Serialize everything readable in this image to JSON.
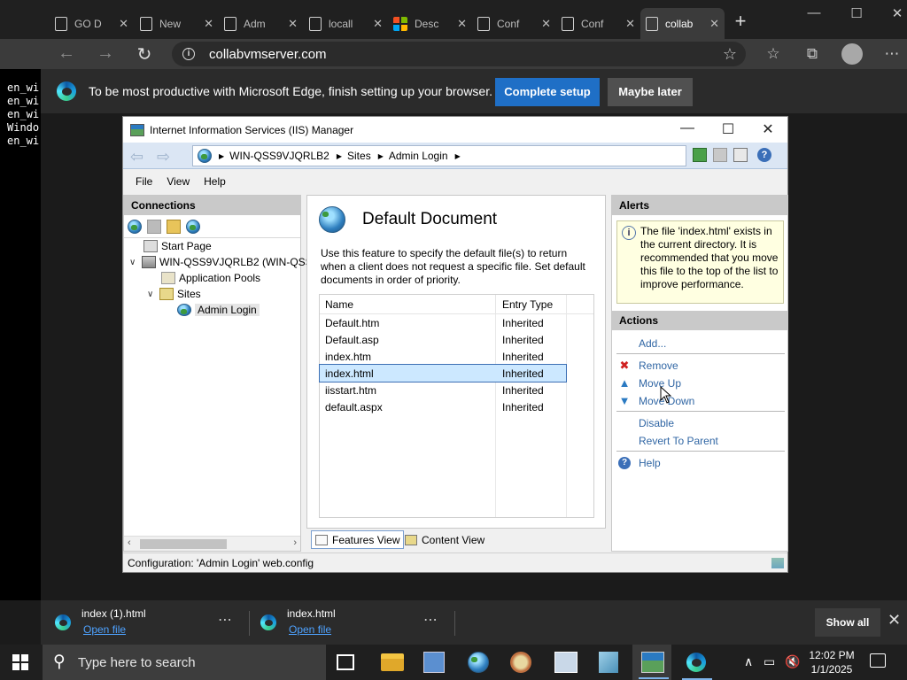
{
  "browser": {
    "tabs": [
      {
        "label": "GO D"
      },
      {
        "label": "New"
      },
      {
        "label": "Adm"
      },
      {
        "label": "locall"
      },
      {
        "label": "Desc"
      },
      {
        "label": "Conf"
      },
      {
        "label": "Conf"
      },
      {
        "label": "collab"
      }
    ],
    "url": "collabvmserver.com",
    "infobar": {
      "message": "To be most productive with Microsoft Edge, finish setting up your browser.",
      "primary_button": "Complete setup",
      "secondary_button": "Maybe later"
    }
  },
  "console": {
    "lines": [
      "en_wir",
      "en_wir",
      "en_wir",
      "Windo",
      "en_wir"
    ]
  },
  "iis": {
    "title": "Internet Information Services (IIS) Manager",
    "breadcrumb": [
      "WIN-QSS9VJQRLB2",
      "Sites",
      "Admin Login"
    ],
    "menu": [
      "File",
      "View",
      "Help"
    ],
    "connections": {
      "header": "Connections",
      "tree": {
        "start_page": "Start Page",
        "server": "WIN-QSS9VJQRLB2 (WIN-QSS",
        "app_pools": "Application Pools",
        "sites": "Sites",
        "site": "Admin Login"
      }
    },
    "feature": {
      "title": "Default Document",
      "description": "Use this feature to specify the default file(s) to return when a client does not request a specific file. Set default documents in order of priority.",
      "columns": [
        "Name",
        "Entry Type"
      ],
      "rows": [
        {
          "name": "Default.htm",
          "type": "Inherited"
        },
        {
          "name": "Default.asp",
          "type": "Inherited"
        },
        {
          "name": "index.htm",
          "type": "Inherited"
        },
        {
          "name": "index.html",
          "type": "Inherited"
        },
        {
          "name": "iisstart.htm",
          "type": "Inherited"
        },
        {
          "name": "default.aspx",
          "type": "Inherited"
        }
      ],
      "selected_row": "index.html"
    },
    "view_tabs": {
      "features": "Features View",
      "content": "Content View"
    },
    "alerts": {
      "header": "Alerts",
      "message": "The file 'index.html' exists in the current directory. It is recommended that you move this file to the top of the list to improve performance."
    },
    "actions": {
      "header": "Actions",
      "add": "Add...",
      "remove": "Remove",
      "move_up": "Move Up",
      "move_down": "Move Down",
      "disable": "Disable",
      "revert": "Revert To Parent",
      "help": "Help"
    },
    "status": "Configuration: 'Admin Login' web.config"
  },
  "downloads": {
    "items": [
      {
        "file": "index (1).html",
        "action": "Open file"
      },
      {
        "file": "index.html",
        "action": "Open file"
      }
    ],
    "show_all": "Show all"
  },
  "taskbar": {
    "search_placeholder": "Type here to search",
    "time": "12:02 PM",
    "date": "1/1/2025"
  }
}
